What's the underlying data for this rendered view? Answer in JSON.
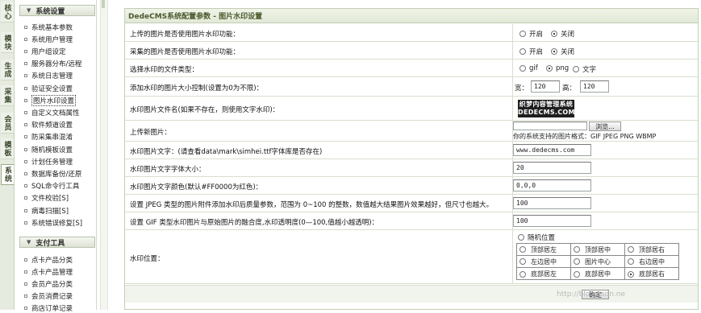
{
  "vertical_tabs": [
    "核心",
    "模块",
    "生成",
    "采集",
    "会员",
    "模板",
    "系统"
  ],
  "sidebar": {
    "section1_title": "系统设置",
    "section1_items": [
      "系统基本参数",
      "系统用户管理",
      "用户组设定",
      "服务器分布/远程",
      "系统日志管理",
      "验证安全设置",
      "图片水印设置",
      "自定义文档属性",
      "软件频道设置",
      "防采集串混淆",
      "随机模板设置",
      "计划任务管理",
      "数据库备份/还原",
      "SQL命令行工具",
      "文件校验[S]",
      "病毒扫描[S]",
      "系统错误修复[S]"
    ],
    "section2_title": "支付工具",
    "section2_items": [
      "点卡产品分类",
      "点卡产品管理",
      "会员产品分类",
      "会员消费记录",
      "商店订单记录"
    ]
  },
  "form": {
    "title": "DedeCMS系统配置参数 - 图片水印设置",
    "rows": {
      "upload_watermark": {
        "label": "上传的图片是否使用图片水印功能：",
        "opt_on": "开启",
        "opt_off": "关闭"
      },
      "collect_watermark": {
        "label": "采集的图片是否使用图片水印功能：",
        "opt_on": "开启",
        "opt_off": "关闭"
      },
      "file_type": {
        "label": "选择水印的文件类型：",
        "opt_gif": "gif",
        "opt_png": "png",
        "opt_text": "文字"
      },
      "size_limit": {
        "label": "添加水印的图片大小控制(设置为0为不限)：",
        "width_label": "宽：",
        "width_value": "120",
        "height_label": "高：",
        "height_value": "120"
      },
      "image_file": {
        "label": "水印图片文件名(如果不存在，则使用文字水印)：",
        "logo_line1": "织梦内容管理系统",
        "logo_line2": "DEDECMS.COM"
      },
      "upload_image": {
        "label": "上传新图片：",
        "browse": "浏览...",
        "formats": "你的系统支持的图片格式：GIF JPEG PNG WBMP"
      },
      "text": {
        "label": "水印图片文字：(请查看data\\mark\\simhei.ttf字体库是否存在)",
        "value": "www.dedecms.com"
      },
      "font_size": {
        "label": "水印图片文字字体大小：",
        "value": "20"
      },
      "font_color": {
        "label": "水印图片文字颜色(默认#FF0000为红色)：",
        "value": "0,0,0"
      },
      "jpeg_quality": {
        "label": "设置 JPEG 类型的图片附件添加水印后质量参数，范围为 0~100 的整数，数值越大结果图片效果越好，但尺寸也越大。",
        "value": "100"
      },
      "gif_alpha": {
        "label": "设置 GIF 类型水印图片与原始图片的融合度,水印透明度(0—100,值越小越透明)：",
        "value": "100"
      },
      "position": {
        "label": "水印位置：",
        "random": "随机位置",
        "cells": [
          "顶部居左",
          "顶部居中",
          "顶部居右",
          "左边居中",
          "图片中心",
          "右边居中",
          "底部居左",
          "底部居中",
          "底部居右"
        ]
      }
    },
    "confirm": "确定"
  },
  "watermark_text": "http://blog.csdn.ne"
}
